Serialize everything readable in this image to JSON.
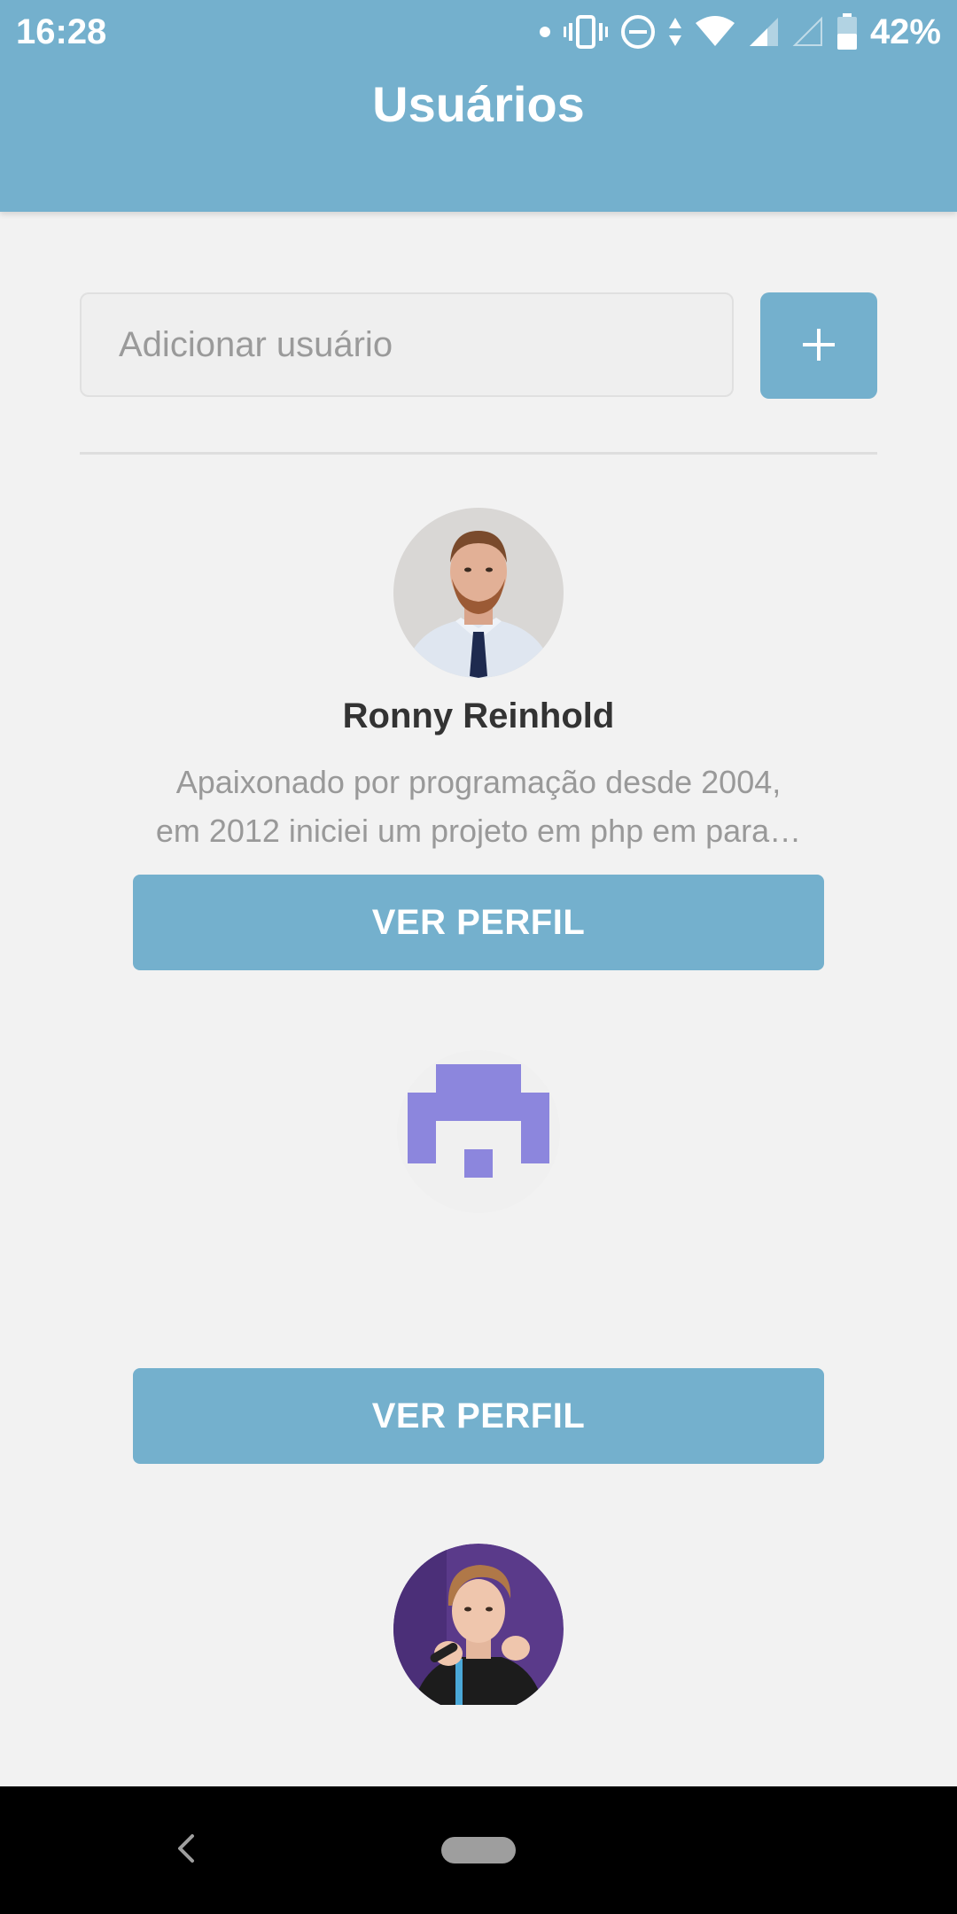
{
  "status_bar": {
    "time": "16:28",
    "battery_percent": "42%",
    "icons": [
      "notification-dot-icon",
      "vibrate-icon",
      "do-not-disturb-icon",
      "data-transfer-icon",
      "wifi-icon",
      "cell-signal-icon",
      "cell-signal-empty-icon",
      "battery-icon"
    ]
  },
  "app_bar": {
    "title": "Usuários"
  },
  "add_user": {
    "placeholder": "Adicionar usuário",
    "value": "",
    "button_icon": "plus-icon"
  },
  "users": [
    {
      "name": "Ronny Reinhold",
      "bio_line_1": "Apaixonado por programação desde 2004,",
      "bio_line_2": "em 2012 iniciei um projeto em php em para…",
      "button_label": "VER PERFIL",
      "avatar": "photo-avatar"
    },
    {
      "name": "",
      "bio_line_1": "",
      "bio_line_2": "",
      "button_label": "VER PERFIL",
      "avatar": "identicon-avatar"
    },
    {
      "avatar": "photo-avatar"
    }
  ],
  "colors": {
    "primary": "#74b0cd",
    "background": "#f2f2f2",
    "identicon": "#8c86dd",
    "name_text": "#333333",
    "bio_text": "#999999"
  },
  "nav_bar": {
    "icons": [
      "back-icon",
      "home-pill-icon"
    ]
  }
}
